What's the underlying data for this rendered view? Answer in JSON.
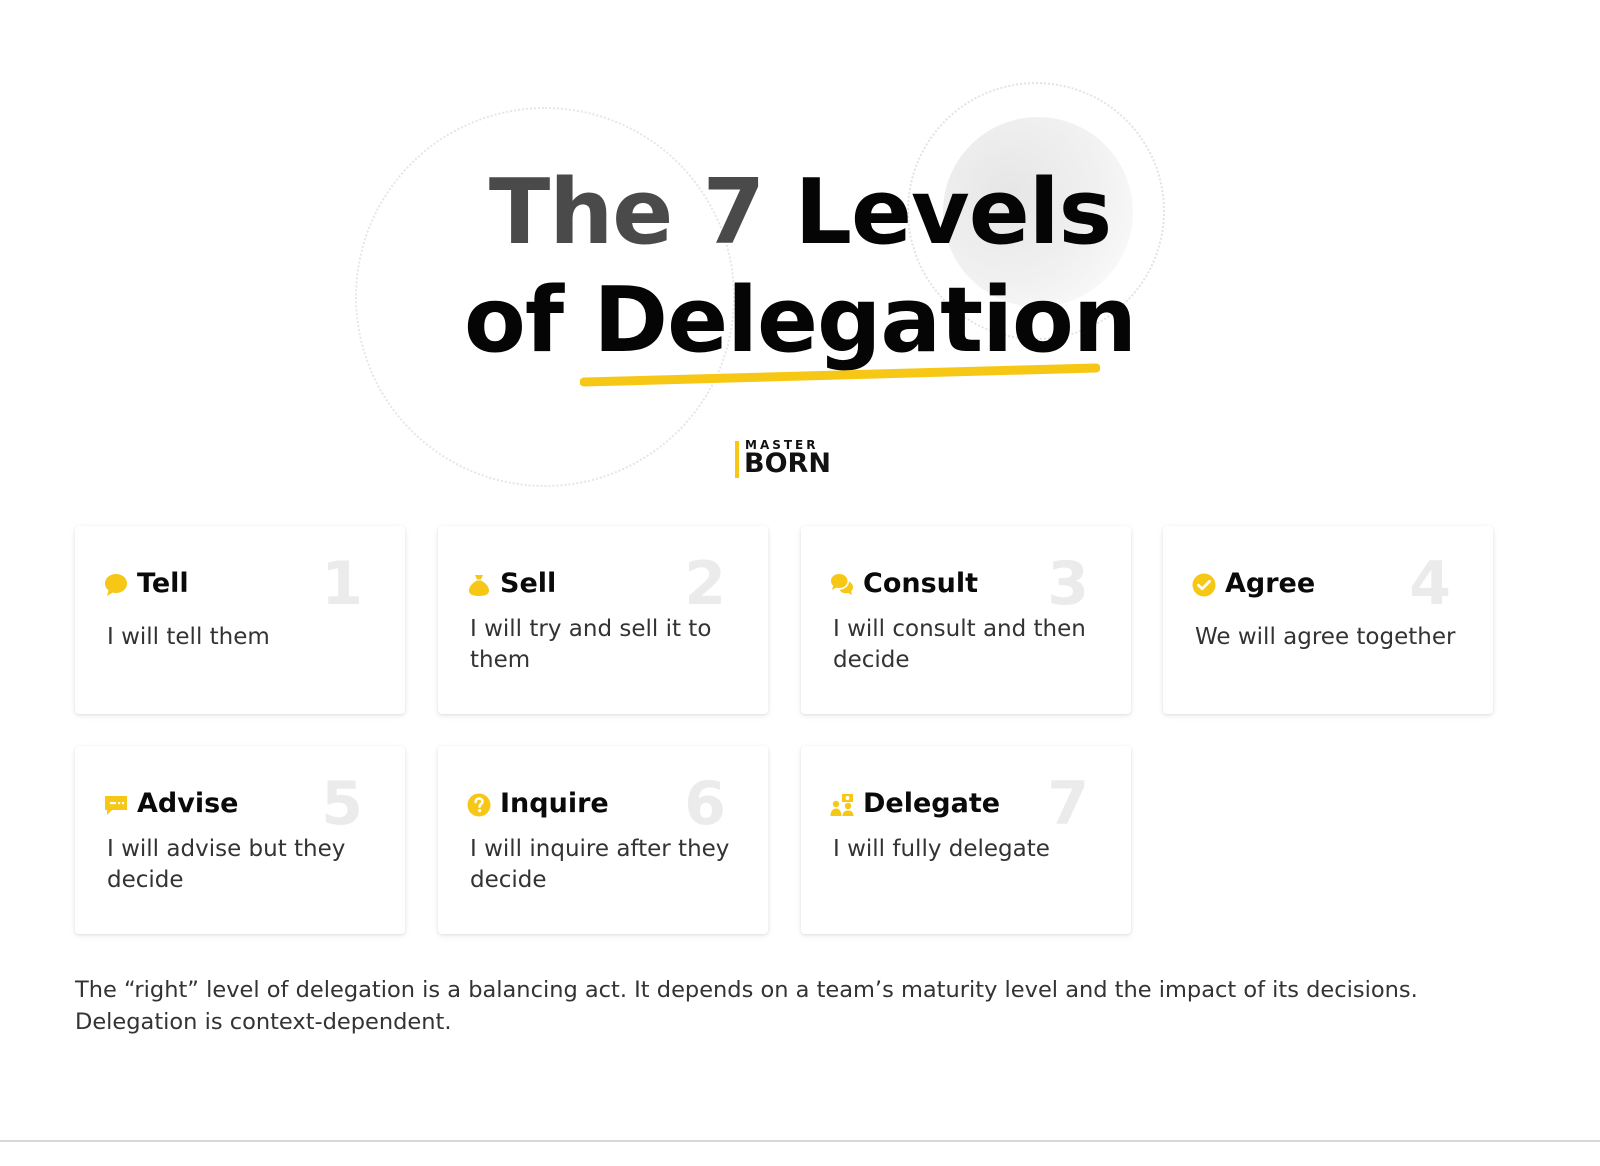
{
  "title": {
    "line1_part1": "The 7",
    "line1_part2": "Levels",
    "line2_part1": "of",
    "line2_part2": "Delegation"
  },
  "logo": {
    "top": "MASTER",
    "bottom": "BORN"
  },
  "colors": {
    "accent": "#f7c716",
    "text": "#111111",
    "muted_number": "#ebebeb"
  },
  "levels": [
    {
      "number": "1",
      "name": "Tell",
      "description": "I will tell them",
      "icon": "speech-bubble-icon"
    },
    {
      "number": "2",
      "name": "Sell",
      "description": "I will try and sell it to them",
      "icon": "money-bag-icon"
    },
    {
      "number": "3",
      "name": "Consult",
      "description": "I will consult and then decide",
      "icon": "chat-bubbles-icon"
    },
    {
      "number": "4",
      "name": "Agree",
      "description": "We will agree together",
      "icon": "check-circle-icon"
    },
    {
      "number": "5",
      "name": "Advise",
      "description": "I will advise but they decide",
      "icon": "message-icon"
    },
    {
      "number": "6",
      "name": "Inquire",
      "description": "I will inquire after they decide",
      "icon": "question-circle-icon"
    },
    {
      "number": "7",
      "name": "Delegate",
      "description": "I will fully delegate",
      "icon": "people-delegate-icon"
    }
  ],
  "footnote": "The “right” level of delegation is a balancing act. It depends on a team’s maturity level and the impact of its decisions. Delegation is context-dependent."
}
